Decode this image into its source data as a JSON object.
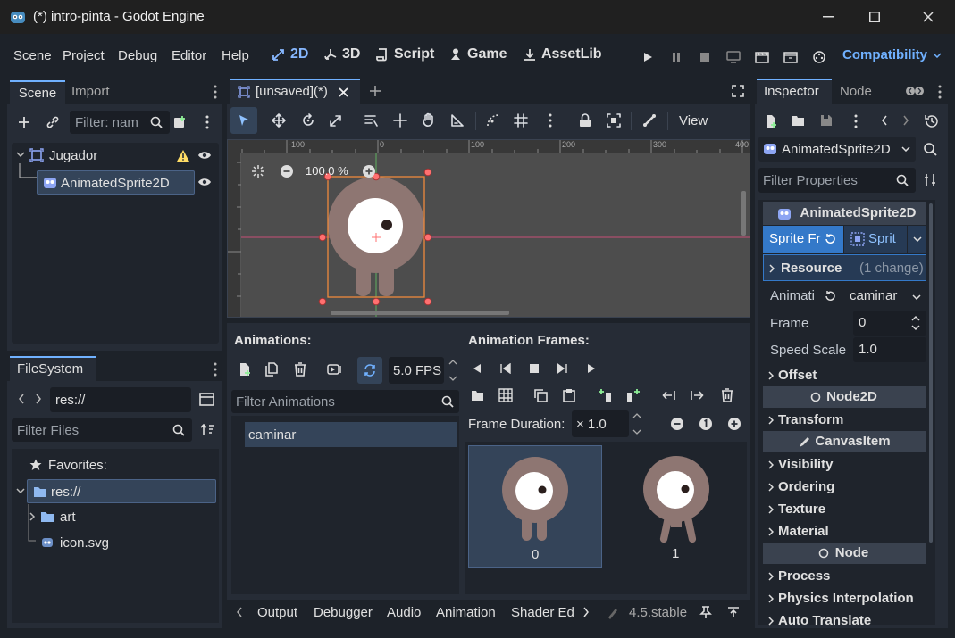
{
  "window": {
    "title": "(*) intro-pinta - Godot Engine"
  },
  "menu": {
    "items": [
      "Scene",
      "Project",
      "Debug",
      "Editor",
      "Help"
    ],
    "workspaces": [
      "2D",
      "3D",
      "Script",
      "Game",
      "AssetLib"
    ],
    "renderer": "Compatibility"
  },
  "scene_dock": {
    "tabs": [
      "Scene",
      "Import"
    ],
    "filter_placeholder": "Filter: nam",
    "nodes": [
      "Jugador",
      "AnimatedSprite2D"
    ]
  },
  "filesystem": {
    "tab": "FileSystem",
    "path": "res://",
    "filter_placeholder": "Filter Files",
    "favorites": "Favorites:",
    "items": [
      "res://",
      "art",
      "icon.svg"
    ]
  },
  "viewport": {
    "tab": "[unsaved](*)",
    "view_label": "View",
    "zoom": "100.0 %",
    "ruler": [
      "-100",
      "0",
      "100",
      "200",
      "300",
      "400"
    ]
  },
  "animations": {
    "title": "Animations:",
    "fps": "5.0 FPS",
    "filter_placeholder": "Filter Animations",
    "list": [
      "caminar"
    ]
  },
  "frames": {
    "title": "Animation Frames:",
    "duration_label": "Frame Duration:",
    "duration_value": "× 1.0",
    "items": [
      "0",
      "1"
    ]
  },
  "bottom": {
    "tabs": [
      "Output",
      "Debugger",
      "Audio",
      "Animation",
      "Shader Edi"
    ],
    "version": "4.5.stable"
  },
  "inspector": {
    "tabs": [
      "Inspector",
      "Node"
    ],
    "node_name": "AnimatedSprite2D",
    "filter_placeholder": "Filter Properties",
    "class_header": "AnimatedSprite2D",
    "sprite_frames_label": "Sprite Fr",
    "sprite_frames_value": "Sprit",
    "resource": "Resource",
    "resource_changes": "(1 change)",
    "props": [
      {
        "label": "Animati",
        "value": "caminar"
      },
      {
        "label": "Frame",
        "value": "0"
      },
      {
        "label": "Speed Scale",
        "value": "1.0"
      }
    ],
    "sections1": [
      "Offset"
    ],
    "node2d": "Node2D",
    "sections2": [
      "Transform"
    ],
    "canvasitem": "CanvasItem",
    "sections3": [
      "Visibility",
      "Ordering",
      "Texture",
      "Material"
    ],
    "node": "Node",
    "sections4": [
      "Process",
      "Physics Interpolation",
      "Auto Translate"
    ]
  },
  "colors": {
    "accent": "#70b1ff",
    "workspace_active": "#87b8ff",
    "warning": "#ffdd65"
  }
}
